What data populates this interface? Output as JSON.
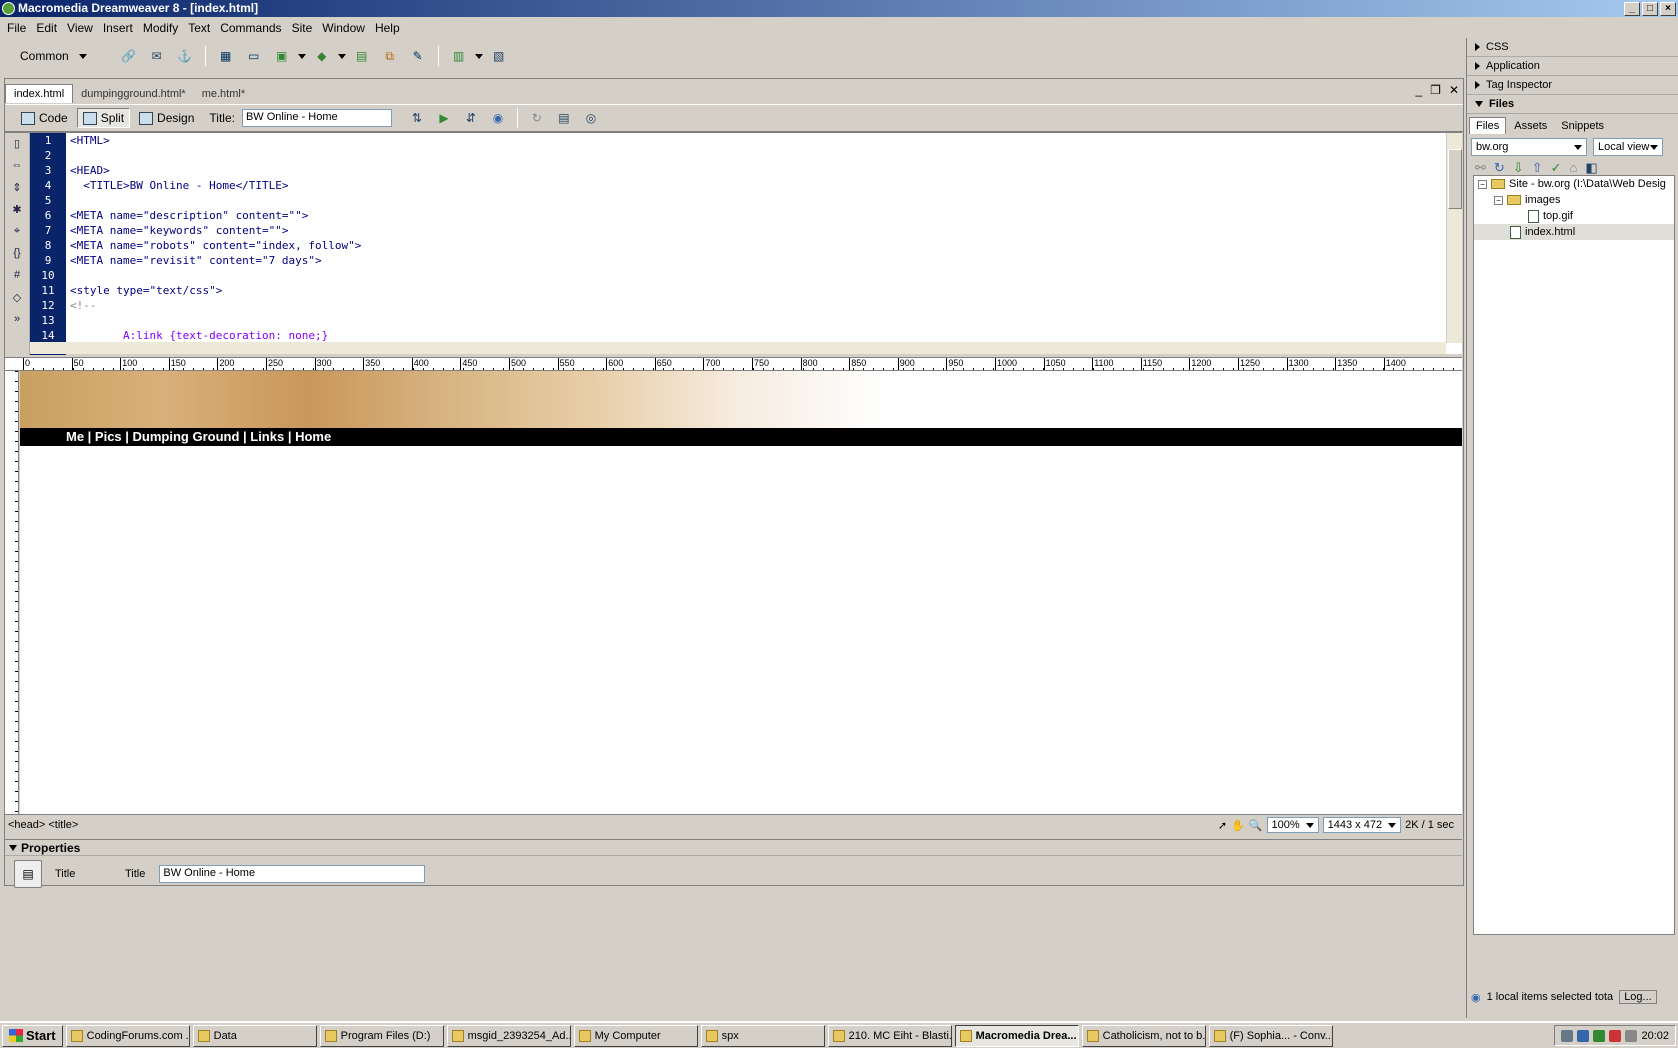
{
  "window": {
    "title": "Macromedia Dreamweaver 8 - [index.html]"
  },
  "menu": [
    "File",
    "Edit",
    "View",
    "Insert",
    "Modify",
    "Text",
    "Commands",
    "Site",
    "Window",
    "Help"
  ],
  "insert_bar": {
    "category": "Common"
  },
  "doc_tabs": [
    "index.html",
    "dumpingground.html*",
    "me.html*"
  ],
  "doc_toolbar": {
    "code": "Code",
    "split": "Split",
    "design": "Design",
    "title_label": "Title:",
    "title_value": "BW Online - Home"
  },
  "code": {
    "line_numbers": [
      "1",
      "2",
      "3",
      "4",
      "5",
      "6",
      "7",
      "8",
      "9",
      "10",
      "11",
      "12",
      "13",
      "14"
    ],
    "lines": [
      "<HTML>",
      "",
      "<HEAD>",
      "  <TITLE>BW Online - Home</TITLE>",
      "",
      "<META name=\"description\" content=\"\">",
      "<META name=\"keywords\" content=\"\">",
      "<META name=\"robots\" content=\"index, follow\">",
      "<META name=\"revisit\" content=\"7 days\">",
      "",
      "<style type=\"text/css\">",
      "<!--",
      "",
      "        A:link {text-decoration: none;}"
    ]
  },
  "ruler": [
    "0",
    "50",
    "100",
    "150",
    "200",
    "250",
    "300",
    "350",
    "400",
    "450",
    "500",
    "550",
    "600",
    "650",
    "700",
    "750",
    "800",
    "850",
    "900",
    "950",
    "1000",
    "1050",
    "1100",
    "1150",
    "1200",
    "1250",
    "1300",
    "1350",
    "1400"
  ],
  "design": {
    "nav": "Me | Pics | Dumping Ground | Links | Home"
  },
  "status": {
    "tags": "<head> <title>",
    "zoom": "100%",
    "size": "1443 x 472",
    "download": "2K / 1 sec"
  },
  "properties": {
    "header": "Properties",
    "kind": "Title",
    "title_label": "Title",
    "title_value": "BW Online - Home"
  },
  "panels": {
    "css": "CSS",
    "application": "Application",
    "tag_inspector": "Tag Inspector",
    "files": "Files",
    "tabs": [
      "Files",
      "Assets",
      "Snippets"
    ],
    "site": "bw.org",
    "view": "Local view",
    "tree": {
      "root": "Site - bw.org (I:\\Data\\Web Desig",
      "folder": "images",
      "file1": "top.gif",
      "file2": "index.html"
    },
    "status": "1 local items selected tota",
    "log": "Log..."
  },
  "taskbar": {
    "start": "Start",
    "items": [
      "CodingForums.com ...",
      "Data",
      "Program Files (D:)",
      "msgid_2393254_Ad...",
      "My Computer",
      "spx",
      "210. MC Eiht - Blasti...",
      "Macromedia Drea...",
      "Catholicism, not to b...",
      "(F) Sophia... - Conv..."
    ],
    "clock": "20:02"
  }
}
